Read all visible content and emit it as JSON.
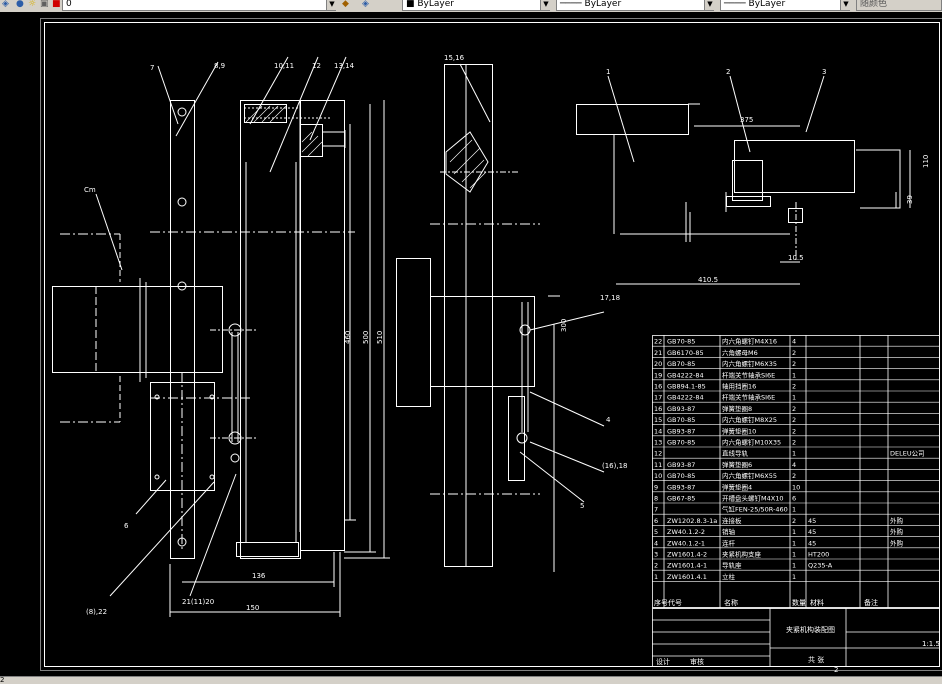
{
  "toolbar": {
    "layer_value": "0",
    "color_value": "ByLayer",
    "linetype_value": "ByLayer",
    "lineweight_value": "ByLayer",
    "plotstyle_value": "随颜色"
  },
  "drawing": {
    "callouts": {
      "c1": "1",
      "c2": "2",
      "c3": "3",
      "c4": "4",
      "c5": "5",
      "c6": "6",
      "c7": "7",
      "c89": "8,9",
      "c1011": "10,11",
      "c12": "12",
      "c1314": "13,14",
      "c1516": "15,16",
      "c1718": "17,18",
      "c1618b": "(16),18",
      "c822": "(8),22",
      "c2120": "21(11)20",
      "cleft": "Cm"
    },
    "dims": {
      "d136": "136",
      "d150": "150",
      "d460": "460",
      "d500": "500",
      "d510": "510",
      "d300": "300",
      "d375": "375",
      "d110": "110",
      "d39": "39",
      "d105": "10.5",
      "d4105": "410.5"
    }
  },
  "bom": {
    "rows": [
      {
        "no": "22",
        "code": "GB70-85",
        "name": "内六角螺钉M4X16",
        "qty": "4",
        "mat": "",
        "note": ""
      },
      {
        "no": "21",
        "code": "GB6170-85",
        "name": "六角螺母M6",
        "qty": "2",
        "mat": "",
        "note": ""
      },
      {
        "no": "20",
        "code": "GB70-85",
        "name": "内六角螺钉M6X35",
        "qty": "2",
        "mat": "",
        "note": ""
      },
      {
        "no": "19",
        "code": "GB4222-84",
        "name": "杆端关节轴承SI6E",
        "qty": "1",
        "mat": "",
        "note": ""
      },
      {
        "no": "16",
        "code": "GB894.1-85",
        "name": "轴用挡圈16",
        "qty": "2",
        "mat": "",
        "note": ""
      },
      {
        "no": "17",
        "code": "GB4222-84",
        "name": "杆端关节轴承SI6E",
        "qty": "1",
        "mat": "",
        "note": ""
      },
      {
        "no": "16",
        "code": "GB93-87",
        "name": "弹簧垫圈8",
        "qty": "2",
        "mat": "",
        "note": ""
      },
      {
        "no": "15",
        "code": "GB70-85",
        "name": "内六角螺钉M8X25",
        "qty": "2",
        "mat": "",
        "note": ""
      },
      {
        "no": "14",
        "code": "GB93-87",
        "name": "弹簧垫圈10",
        "qty": "2",
        "mat": "",
        "note": ""
      },
      {
        "no": "13",
        "code": "GB70-85",
        "name": "内六角螺钉M10X35",
        "qty": "2",
        "mat": "",
        "note": ""
      },
      {
        "no": "12",
        "code": "",
        "name": "直线导轨",
        "qty": "1",
        "mat": "",
        "note": "DELEU公司"
      },
      {
        "no": "11",
        "code": "GB93-87",
        "name": "弹簧垫圈6",
        "qty": "4",
        "mat": "",
        "note": ""
      },
      {
        "no": "10",
        "code": "GB70-85",
        "name": "内六角螺钉M6X55",
        "qty": "2",
        "mat": "",
        "note": ""
      },
      {
        "no": "9",
        "code": "GB93-87",
        "name": "弹簧垫圈4",
        "qty": "10",
        "mat": "",
        "note": ""
      },
      {
        "no": "8",
        "code": "GB67-85",
        "name": "开槽盘头螺钉M4X10",
        "qty": "6",
        "mat": "",
        "note": ""
      },
      {
        "no": "7",
        "code": "",
        "name": "气缸FEN-25/50R-460",
        "qty": "1",
        "mat": "",
        "note": ""
      },
      {
        "no": "6",
        "code": "ZW1202.8.3-1a",
        "name": "连接板",
        "qty": "2",
        "mat": "45",
        "note": "外购"
      },
      {
        "no": "5",
        "code": "ZW40.1.2-2",
        "name": "销轴",
        "qty": "1",
        "mat": "45",
        "note": "外购"
      },
      {
        "no": "4",
        "code": "ZW40.1.2-1",
        "name": "连杆",
        "qty": "1",
        "mat": "45",
        "note": "外购"
      },
      {
        "no": "3",
        "code": "ZW1601.4-2",
        "name": "夹紧机构支座",
        "qty": "1",
        "mat": "HT200",
        "note": ""
      },
      {
        "no": "2",
        "code": "ZW1601.4-1",
        "name": "导轨座",
        "qty": "1",
        "mat": "Q235-A",
        "note": ""
      },
      {
        "no": "1",
        "code": "ZW1601.4.1",
        "name": "立柱",
        "qty": "1",
        "mat": "",
        "note": ""
      }
    ],
    "header": {
      "no": "序号",
      "code": "代号",
      "name": "名称",
      "qty": "数量",
      "mat": "材料",
      "note": "备注"
    }
  },
  "titleblock": {
    "drawing_name": "夹紧机构装配图",
    "scale": "1:1.5",
    "sheets": "2",
    "sheet_label": "共 张",
    "design": "设计",
    "check": "审核"
  },
  "status": {
    "coords": "2"
  }
}
